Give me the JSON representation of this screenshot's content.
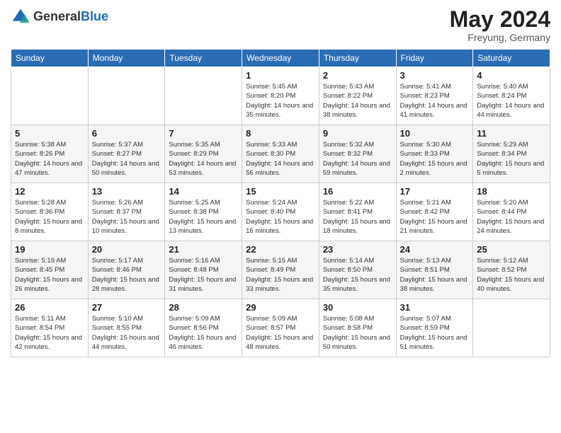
{
  "header": {
    "logo_general": "General",
    "logo_blue": "Blue",
    "title": "May 2024",
    "location": "Freyung, Germany"
  },
  "weekdays": [
    "Sunday",
    "Monday",
    "Tuesday",
    "Wednesday",
    "Thursday",
    "Friday",
    "Saturday"
  ],
  "weeks": [
    [
      {
        "day": "",
        "info": ""
      },
      {
        "day": "",
        "info": ""
      },
      {
        "day": "",
        "info": ""
      },
      {
        "day": "1",
        "info": "Sunrise: 5:45 AM\nSunset: 8:20 PM\nDaylight: 14 hours\nand 35 minutes."
      },
      {
        "day": "2",
        "info": "Sunrise: 5:43 AM\nSunset: 8:22 PM\nDaylight: 14 hours\nand 38 minutes."
      },
      {
        "day": "3",
        "info": "Sunrise: 5:41 AM\nSunset: 8:23 PM\nDaylight: 14 hours\nand 41 minutes."
      },
      {
        "day": "4",
        "info": "Sunrise: 5:40 AM\nSunset: 8:24 PM\nDaylight: 14 hours\nand 44 minutes."
      }
    ],
    [
      {
        "day": "5",
        "info": "Sunrise: 5:38 AM\nSunset: 8:26 PM\nDaylight: 14 hours\nand 47 minutes."
      },
      {
        "day": "6",
        "info": "Sunrise: 5:37 AM\nSunset: 8:27 PM\nDaylight: 14 hours\nand 50 minutes."
      },
      {
        "day": "7",
        "info": "Sunrise: 5:35 AM\nSunset: 8:29 PM\nDaylight: 14 hours\nand 53 minutes."
      },
      {
        "day": "8",
        "info": "Sunrise: 5:33 AM\nSunset: 8:30 PM\nDaylight: 14 hours\nand 56 minutes."
      },
      {
        "day": "9",
        "info": "Sunrise: 5:32 AM\nSunset: 8:32 PM\nDaylight: 14 hours\nand 59 minutes."
      },
      {
        "day": "10",
        "info": "Sunrise: 5:30 AM\nSunset: 8:33 PM\nDaylight: 15 hours\nand 2 minutes."
      },
      {
        "day": "11",
        "info": "Sunrise: 5:29 AM\nSunset: 8:34 PM\nDaylight: 15 hours\nand 5 minutes."
      }
    ],
    [
      {
        "day": "12",
        "info": "Sunrise: 5:28 AM\nSunset: 8:36 PM\nDaylight: 15 hours\nand 8 minutes."
      },
      {
        "day": "13",
        "info": "Sunrise: 5:26 AM\nSunset: 8:37 PM\nDaylight: 15 hours\nand 10 minutes."
      },
      {
        "day": "14",
        "info": "Sunrise: 5:25 AM\nSunset: 8:38 PM\nDaylight: 15 hours\nand 13 minutes."
      },
      {
        "day": "15",
        "info": "Sunrise: 5:24 AM\nSunset: 8:40 PM\nDaylight: 15 hours\nand 16 minutes."
      },
      {
        "day": "16",
        "info": "Sunrise: 5:22 AM\nSunset: 8:41 PM\nDaylight: 15 hours\nand 18 minutes."
      },
      {
        "day": "17",
        "info": "Sunrise: 5:21 AM\nSunset: 8:42 PM\nDaylight: 15 hours\nand 21 minutes."
      },
      {
        "day": "18",
        "info": "Sunrise: 5:20 AM\nSunset: 8:44 PM\nDaylight: 15 hours\nand 24 minutes."
      }
    ],
    [
      {
        "day": "19",
        "info": "Sunrise: 5:19 AM\nSunset: 8:45 PM\nDaylight: 15 hours\nand 26 minutes."
      },
      {
        "day": "20",
        "info": "Sunrise: 5:17 AM\nSunset: 8:46 PM\nDaylight: 15 hours\nand 28 minutes."
      },
      {
        "day": "21",
        "info": "Sunrise: 5:16 AM\nSunset: 8:48 PM\nDaylight: 15 hours\nand 31 minutes."
      },
      {
        "day": "22",
        "info": "Sunrise: 5:15 AM\nSunset: 8:49 PM\nDaylight: 15 hours\nand 33 minutes."
      },
      {
        "day": "23",
        "info": "Sunrise: 5:14 AM\nSunset: 8:50 PM\nDaylight: 15 hours\nand 35 minutes."
      },
      {
        "day": "24",
        "info": "Sunrise: 5:13 AM\nSunset: 8:51 PM\nDaylight: 15 hours\nand 38 minutes."
      },
      {
        "day": "25",
        "info": "Sunrise: 5:12 AM\nSunset: 8:52 PM\nDaylight: 15 hours\nand 40 minutes."
      }
    ],
    [
      {
        "day": "26",
        "info": "Sunrise: 5:11 AM\nSunset: 8:54 PM\nDaylight: 15 hours\nand 42 minutes."
      },
      {
        "day": "27",
        "info": "Sunrise: 5:10 AM\nSunset: 8:55 PM\nDaylight: 15 hours\nand 44 minutes."
      },
      {
        "day": "28",
        "info": "Sunrise: 5:09 AM\nSunset: 8:56 PM\nDaylight: 15 hours\nand 46 minutes."
      },
      {
        "day": "29",
        "info": "Sunrise: 5:09 AM\nSunset: 8:57 PM\nDaylight: 15 hours\nand 48 minutes."
      },
      {
        "day": "30",
        "info": "Sunrise: 5:08 AM\nSunset: 8:58 PM\nDaylight: 15 hours\nand 50 minutes."
      },
      {
        "day": "31",
        "info": "Sunrise: 5:07 AM\nSunset: 8:59 PM\nDaylight: 15 hours\nand 51 minutes."
      },
      {
        "day": "",
        "info": ""
      }
    ]
  ]
}
